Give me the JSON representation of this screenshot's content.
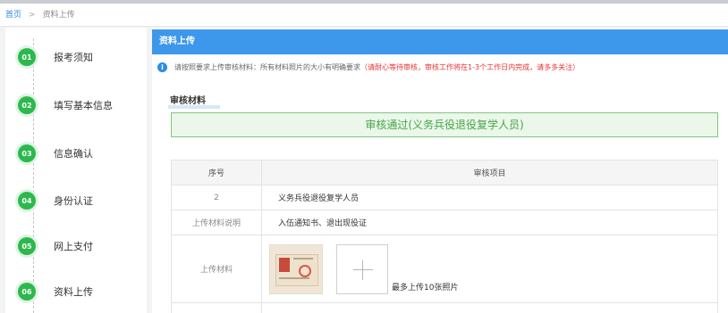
{
  "breadcrumb": {
    "home": "首页",
    "separator": ">",
    "current": "资料上传"
  },
  "steps": [
    {
      "num": "01",
      "label": "报考须知"
    },
    {
      "num": "02",
      "label": "填写基本信息"
    },
    {
      "num": "03",
      "label": "信息确认"
    },
    {
      "num": "04",
      "label": "身份认证"
    },
    {
      "num": "05",
      "label": "网上支付"
    },
    {
      "num": "06",
      "label": "资料上传"
    }
  ],
  "content": {
    "header": "资料上传",
    "notice": {
      "icon": "info-icon",
      "icon_glyph": "i",
      "text": "请按照要求上传审核材料：所有材料照片的大小有明确要求",
      "warning": "（请耐心等待审核，审核工作将在1-3个工作日内完成，请多多关注）"
    },
    "section_title": "审核材料",
    "status": "审核通过(义务兵役退役复学人员)",
    "table": {
      "headers": [
        "序号",
        "审核项目"
      ],
      "rows": [
        {
          "key": "2",
          "value": "义务兵役退役复学人员"
        },
        {
          "key": "上传材料说明",
          "value": "入伍通知书、退出现役证"
        }
      ],
      "upload_label": "上传材料",
      "upload_hint": "最多上传10张照片"
    }
  },
  "colors": {
    "accent": "#3d97ea",
    "step": "#2db84d",
    "success": "#46a546",
    "warning": "#e8322f"
  }
}
